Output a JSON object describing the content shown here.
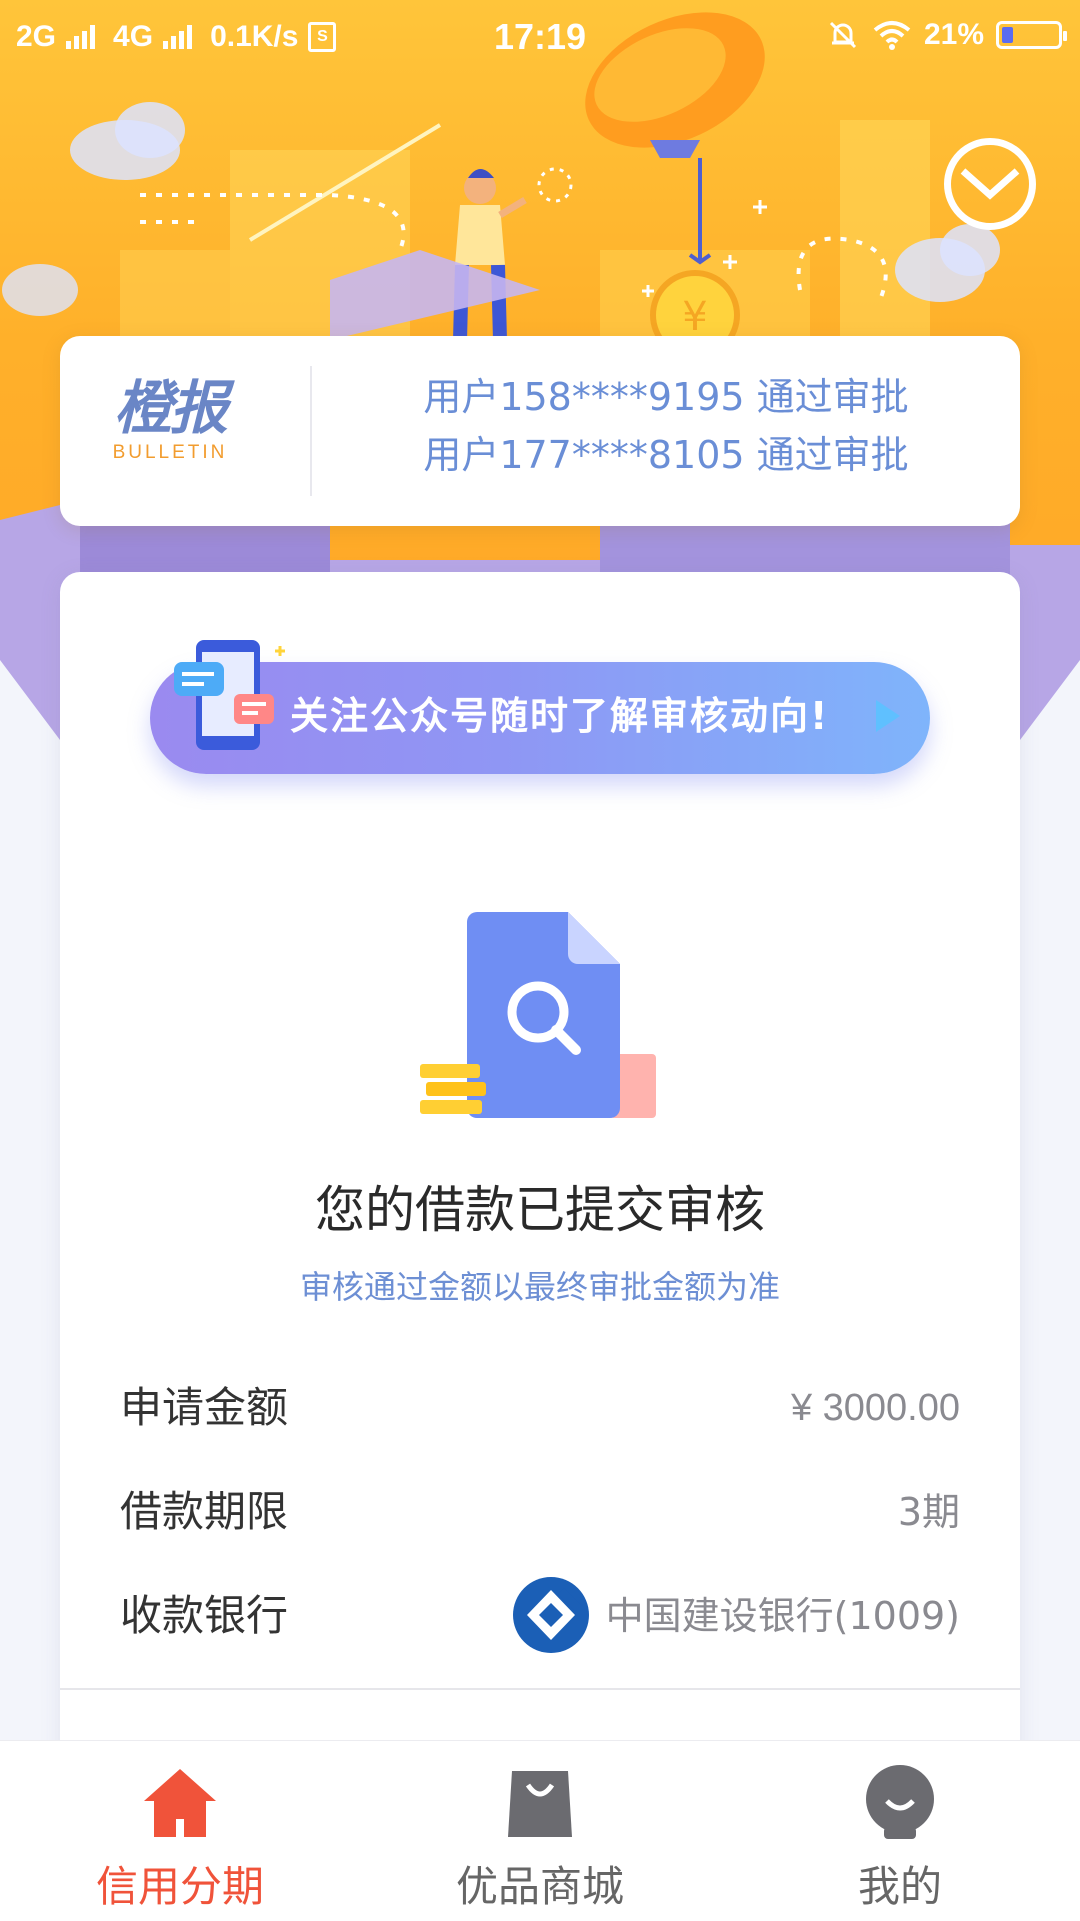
{
  "status_bar": {
    "net1": "2G",
    "net2": "4G",
    "speed": "0.1K/s",
    "time": "17:19",
    "battery": "21%",
    "battery_level": 0.21
  },
  "bulletin": {
    "logo_cn": "橙报",
    "logo_en": "BULLETIN",
    "items": [
      "用户158****9195 通过审批",
      "用户177****8105 通过审批"
    ]
  },
  "banner": {
    "text": "关注公众号随时了解审核动向!"
  },
  "review": {
    "title": "您的借款已提交审核",
    "subtitle": "审核通过金额以最终审批金额为准"
  },
  "details": [
    {
      "label": "申请金额",
      "value": "¥ 3000.00"
    },
    {
      "label": "借款期限",
      "value": "3期"
    },
    {
      "label": "收款银行",
      "value": "中国建设银行(1009)"
    }
  ],
  "tabs": [
    {
      "label": "信用分期",
      "icon": "home-icon",
      "active": true
    },
    {
      "label": "优品商城",
      "icon": "shopping-bag-icon",
      "active": false
    },
    {
      "label": "我的",
      "icon": "profile-icon",
      "active": false
    }
  ],
  "colors": {
    "accent": "#f0533a",
    "hero": "#ffb02a",
    "link_blue": "#6a8ed6"
  }
}
